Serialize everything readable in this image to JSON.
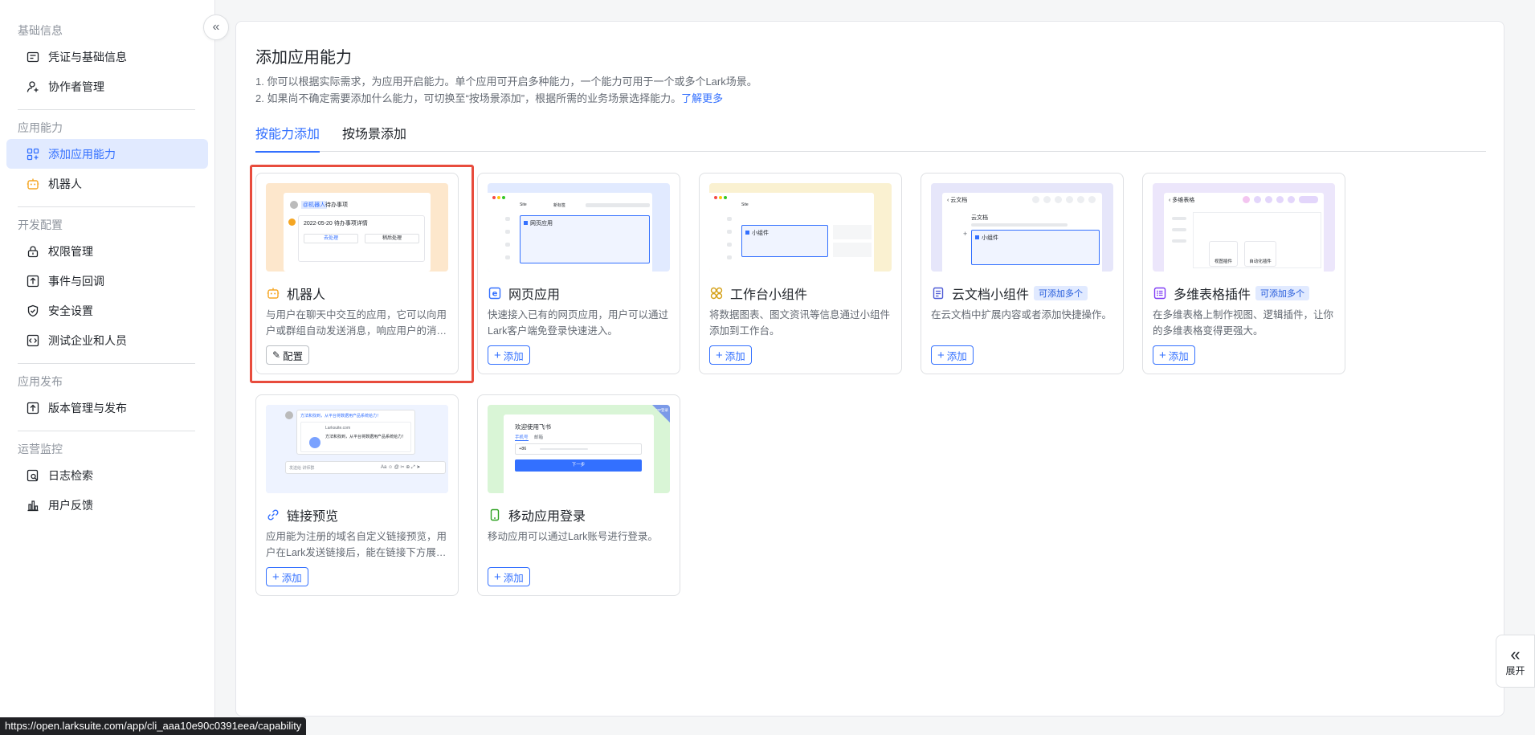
{
  "sidebar": {
    "groups": [
      {
        "title": "基础信息",
        "items": [
          {
            "label": "凭证与基础信息"
          },
          {
            "label": "协作者管理"
          }
        ]
      },
      {
        "title": "应用能力",
        "items": [
          {
            "label": "添加应用能力"
          },
          {
            "label": "机器人"
          }
        ]
      },
      {
        "title": "开发配置",
        "items": [
          {
            "label": "权限管理"
          },
          {
            "label": "事件与回调"
          },
          {
            "label": "安全设置"
          },
          {
            "label": "测试企业和人员"
          }
        ]
      },
      {
        "title": "应用发布",
        "items": [
          {
            "label": "版本管理与发布"
          }
        ]
      },
      {
        "title": "运营监控",
        "items": [
          {
            "label": "日志检索"
          },
          {
            "label": "用户反馈"
          }
        ]
      }
    ]
  },
  "main": {
    "title": "添加应用能力",
    "desc1": "1. 你可以根据实际需求，为应用开启能力。单个应用可开启多种能力，一个能力可用于一个或多个Lark场景。",
    "desc2": "2. 如果尚不确定需要添加什么能力，可切换至“按场景添加”，根据所需的业务场景选择能力。",
    "learn_more": "了解更多",
    "tabs": [
      {
        "label": "按能力添加"
      },
      {
        "label": "按场景添加"
      }
    ]
  },
  "cards": [
    {
      "title": "机器人",
      "desc": "与用户在聊天中交互的应用，它可以向用户或群组自动发送消息，响应用户的消息。",
      "button": "配置"
    },
    {
      "title": "网页应用",
      "desc": "快速接入已有的网页应用，用户可以通过Lark客户端免登录快速进入。",
      "button": "添加"
    },
    {
      "title": "工作台小组件",
      "desc": "将数据图表、图文资讯等信息通过小组件添加到工作台。",
      "button": "添加"
    },
    {
      "title": "云文档小组件",
      "badge": "可添加多个",
      "desc": "在云文档中扩展内容或者添加快捷操作。",
      "button": "添加"
    },
    {
      "title": "多维表格插件",
      "badge": "可添加多个",
      "desc": "在多维表格上制作视图、逻辑插件，让你的多维表格变得更强大。",
      "button": "添加"
    },
    {
      "title": "链接预览",
      "desc": "应用能为注册的域名自定义链接预览，用户在Lark发送链接后，能在链接下方展示预览信息。",
      "button": "添加"
    },
    {
      "title": "移动应用登录",
      "desc": "移动应用可以通过Lark账号进行登录。",
      "button": "添加"
    }
  ],
  "previews": {
    "bot_tag": "@机器人",
    "bot_todo": "待办事项",
    "bot_date": "2022-05-20 待办事项详情",
    "bot_btn1": "去处理",
    "bot_btn2": "稍后处理",
    "web_tab1": "Site",
    "web_tab2": "新标签",
    "web_app": "网页应用",
    "widget_label": "小组件",
    "doc_back": "云文档",
    "doc_title": "云文档",
    "doc_widget": "小组件",
    "base_title": "多维表格",
    "base_view": "视图插件",
    "base_auto": "自动化插件",
    "link_msg": "方法和找到，从平台将数据用产品系统给力！",
    "link_domain": "Larksuite.com",
    "link_body": "方法和找到，从平台将数据用产品系统给力！",
    "link_input": "发送给 讲师群",
    "mobile_welcome": "欢迎使用飞书",
    "mobile_tab1": "手机号",
    "mobile_tab2": "邮箱",
    "mobile_code": "+86",
    "mobile_next": "下一步",
    "mobile_corner": "APP登录"
  },
  "expand_label": "展开",
  "status_url": "https://open.larksuite.com/app/cli_aaa10e90c0391eea/capability"
}
